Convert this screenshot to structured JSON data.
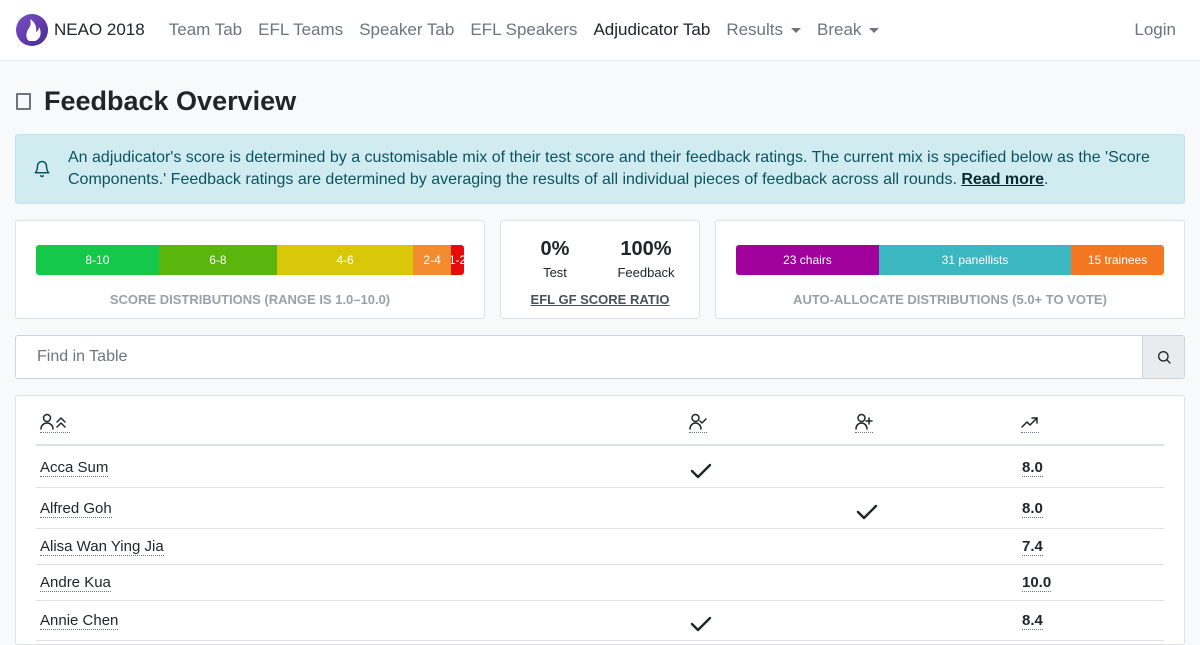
{
  "navbar": {
    "brand": "NEAO 2018",
    "items": [
      {
        "label": "Team Tab",
        "active": false,
        "dropdown": false
      },
      {
        "label": "EFL Teams",
        "active": false,
        "dropdown": false
      },
      {
        "label": "Speaker Tab",
        "active": false,
        "dropdown": false
      },
      {
        "label": "EFL Speakers",
        "active": false,
        "dropdown": false
      },
      {
        "label": "Adjudicator Tab",
        "active": true,
        "dropdown": false
      },
      {
        "label": "Results",
        "active": false,
        "dropdown": true
      },
      {
        "label": "Break",
        "active": false,
        "dropdown": true
      }
    ],
    "login": "Login"
  },
  "page": {
    "title": "Feedback Overview"
  },
  "alert": {
    "text": "An adjudicator's score is determined by a customisable mix of their test score and their feedback ratings. The current mix is specified below as the 'Score Components.' Feedback ratings are determined by averaging the results of all individual pieces of feedback across all rounds.",
    "link": "Read more",
    "suffix": "."
  },
  "score_distribution": {
    "caption": "SCORE DISTRIBUTIONS (RANGE IS 1.0–10.0)",
    "segments": [
      {
        "label": "8-10",
        "share": 0.287,
        "color": "#16c84a"
      },
      {
        "label": "6-8",
        "share": 0.276,
        "color": "#5ab50c"
      },
      {
        "label": "4-6",
        "share": 0.318,
        "color": "#d9c80a"
      },
      {
        "label": "2-4",
        "share": 0.089,
        "color": "#f28c2f"
      },
      {
        "label": "1-2",
        "share": 0.03,
        "color": "#e60c0c"
      }
    ]
  },
  "ratio": {
    "test_value": "0%",
    "test_label": "Test",
    "feedback_value": "100%",
    "feedback_label": "Feedback",
    "link": "EFL GF SCORE RATIO"
  },
  "allocation": {
    "caption": "AUTO-ALLOCATE DISTRIBUTIONS (5.0+ TO VOTE)",
    "segments": [
      {
        "label": "23 chairs",
        "share": 0.334,
        "color": "#a0009b"
      },
      {
        "label": "31 panellists",
        "share": 0.449,
        "color": "#3ab7c0"
      },
      {
        "label": "15 trainees",
        "share": 0.217,
        "color": "#f37721"
      }
    ]
  },
  "search": {
    "placeholder": "Find in Table"
  },
  "table": {
    "headers": {
      "name": "person-sort-icon",
      "chair": "person-check-icon",
      "panellist": "person-plus-icon",
      "score": "trending-up-icon"
    },
    "rows": [
      {
        "name": "Acca Sum",
        "chair": true,
        "panellist": false,
        "score": "8.0"
      },
      {
        "name": "Alfred Goh",
        "chair": false,
        "panellist": true,
        "score": "8.0"
      },
      {
        "name": "Alisa Wan Ying Jia",
        "chair": false,
        "panellist": false,
        "score": "7.4"
      },
      {
        "name": "Andre Kua",
        "chair": false,
        "panellist": false,
        "score": "10.0"
      },
      {
        "name": "Annie Chen",
        "chair": true,
        "panellist": false,
        "score": "8.4"
      }
    ]
  }
}
